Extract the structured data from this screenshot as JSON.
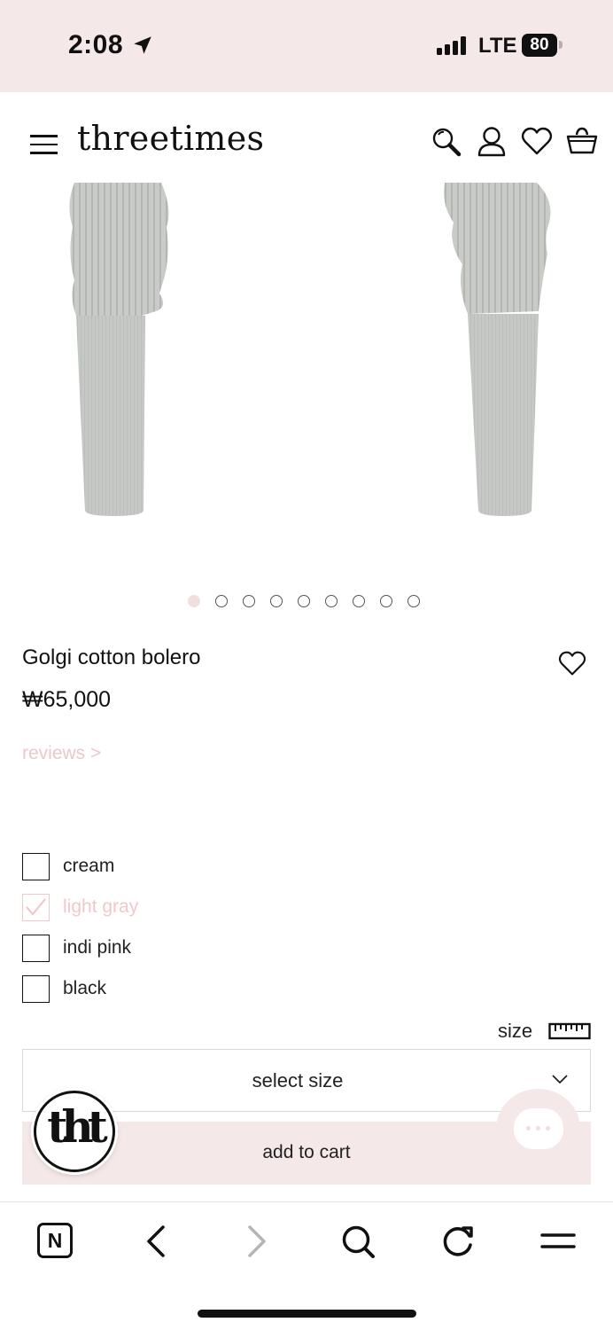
{
  "status_bar": {
    "time": "2:08",
    "network": "LTE",
    "battery": "80"
  },
  "header": {
    "logo": "threetimes"
  },
  "gallery": {
    "slide_count": 9,
    "active_slide": 1
  },
  "product": {
    "name": "Golgi cotton bolero",
    "price": "₩65,000",
    "reviews_link": "reviews >"
  },
  "colors": {
    "options": [
      {
        "label": "cream",
        "checked": false
      },
      {
        "label": "light gray",
        "checked": true
      },
      {
        "label": "indi pink",
        "checked": false
      },
      {
        "label": "black",
        "checked": false
      }
    ]
  },
  "size": {
    "label": "size",
    "select_placeholder": "select size"
  },
  "cart": {
    "add_label": "add to cart"
  },
  "badge": {
    "text": "tht"
  },
  "theme": {
    "accent_pink": "#f4e8e8",
    "selected_text": "#f0c8cc",
    "product_gray": "#c5c7c4"
  }
}
